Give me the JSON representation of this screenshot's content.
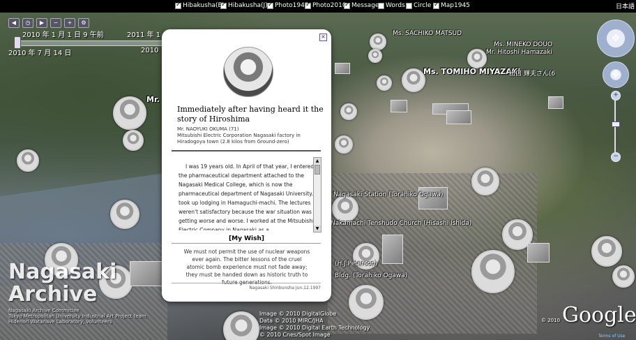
{
  "topbar": {
    "checkboxes": [
      {
        "label": "Hibakusha(E)",
        "checked": true
      },
      {
        "label": "Hibakusha(J)",
        "checked": true
      },
      {
        "label": "Photo1945",
        "checked": true
      },
      {
        "label": "Photo2010",
        "checked": true
      },
      {
        "label": "Message",
        "checked": true
      },
      {
        "label": "Words",
        "checked": false
      },
      {
        "label": "Circle",
        "checked": false
      },
      {
        "label": "Map1945",
        "checked": true
      }
    ],
    "language_link": "日本語"
  },
  "time_panel": {
    "start_time": "2010 年 1 月 1 日 9 午前",
    "end_time_partial": "2011 年 1",
    "current_date": "2010 年 7 月 14 日",
    "current_partial": "2010"
  },
  "map_labels": {
    "sachiko": "Ms. SACHIKO MATSUD",
    "mineko": "Ms. MINEKO DOUO",
    "hitoshi": "Mr. Hitoshi Hamazaki",
    "tomiho": "Ms. TOMIHO MIYAZAKI",
    "deguchi": "出口 輝夫さん(6",
    "mr_left": "Mr.",
    "station": "Nagasaki Station (Torahiko Ogawa)",
    "church": "Nakamachi Tenshudo Church (Hisashi Ishida)",
    "peterson": "(H.J.Peterson)",
    "bldg": "Bldg. (Torahiko Ogawa)"
  },
  "popup": {
    "title": "Immediately after having heard it the story of Hiroshima",
    "name": "Mr. NAOYUKI OKUMA (71)",
    "affiliation": "Mitsubishi Electric Corporation Nagasaki factory in Hiradogoya town (2.8 kilos from Ground-zero)",
    "body": "I was 19 years old. In April of that year, I entered the pharmaceutical department attached to the Nagasaki Medical College, which is now the pharmaceutical department of Nagasaki University. I took up lodging in Hamaguchi-machi. The lectures weren't satisfactory because the war situation was getting worse and worse. I worked at the Mitsubishi Electric Company in Nagasaki as a",
    "wish_heading": "[My Wish]",
    "wish_text": "We must not permit the use of nuclear weapons ever again. The bitter lessons of the cruel atomic bomb experience must not fade away; they must be handed down as historic truth to future generations.",
    "source": "Nagasaki Shinbunsha Jun.12.1997",
    "close_icon": "close-icon"
  },
  "branding": {
    "logo_line1": "Nagasaki",
    "logo_line2": "Archive",
    "credits_lines": [
      "Nagasaki Archive Committee",
      "Tokyo Metropolitan University Industrial Art Project team",
      "Hidenori Watanave Laboratory, volunteers"
    ],
    "map_credits": [
      "Image © 2010 DigitalGlobe",
      "Data © 2010 MIRC/JHA",
      "Image © 2010 Digital Earth Technology",
      "© 2010 Cnes/Spot Image"
    ],
    "google": "Google",
    "google_copy": "© 2010",
    "terms": "Terms of Use"
  },
  "colors": {
    "background": "#000000",
    "popup_bg": "#ffffff"
  }
}
